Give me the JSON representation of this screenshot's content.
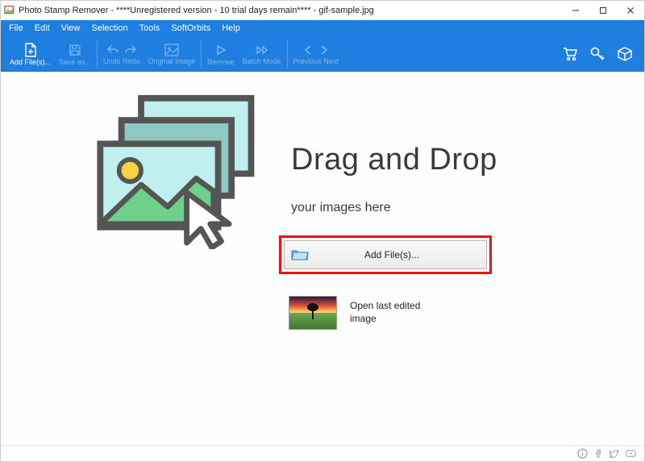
{
  "titlebar": {
    "title": "Photo Stamp Remover - ****Unregistered version - 10 trial days remain**** - gif-sample.jpg"
  },
  "menubar": {
    "items": [
      "File",
      "Edit",
      "View",
      "Selection",
      "Tools",
      "SoftOrbits",
      "Help"
    ]
  },
  "toolbar": {
    "add_files": "Add File(s)...",
    "save_as": "Save as...",
    "undo": "Undo",
    "redo": "Redo",
    "original_image": "Original Image",
    "remove": "Remove",
    "batch_mode": "Batch Mode",
    "previous": "Previous",
    "next": "Next"
  },
  "main": {
    "headline": "Drag and Drop",
    "subline": "your images here",
    "add_files_button": "Add File(s)...",
    "open_last_edited": "Open last edited image"
  }
}
